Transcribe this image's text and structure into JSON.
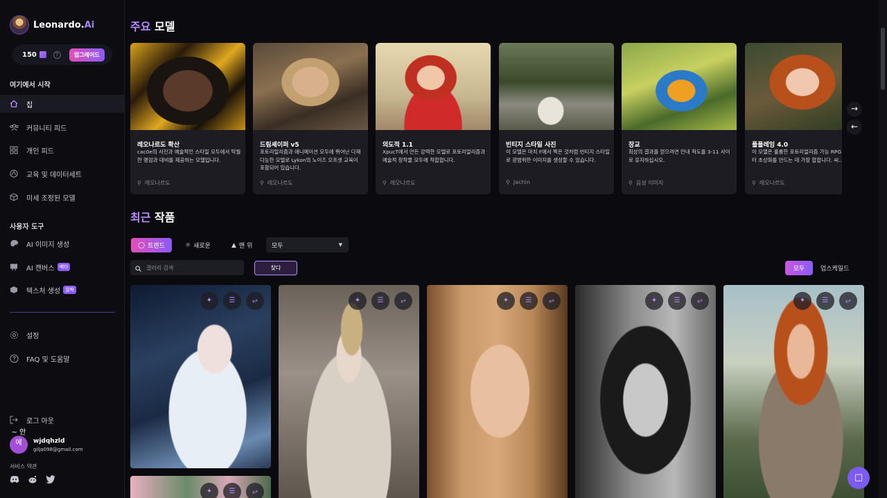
{
  "brand": {
    "name": "Leonardo.",
    "ai": "Ai"
  },
  "credits": {
    "amount": "150",
    "upgrade_label": "업그레이드"
  },
  "sidebar": {
    "start_heading": "여기에서 시작",
    "start_items": [
      {
        "label": "집",
        "icon": "home-icon"
      },
      {
        "label": "커뮤니티 피드",
        "icon": "users-icon"
      },
      {
        "label": "개인 피드",
        "icon": "grid-icon"
      },
      {
        "label": "교육 및 데이터세트",
        "icon": "dataset-icon"
      },
      {
        "label": "미세 조정된 모델",
        "icon": "cube-icon"
      }
    ],
    "tools_heading": "사용자 도구",
    "tool_items": [
      {
        "label": "AI 이미지 생성",
        "icon": "palette-icon",
        "badge": ""
      },
      {
        "label": "AI 캔버스",
        "icon": "canvas-icon",
        "badge": "베타"
      },
      {
        "label": "텍스처 생성",
        "icon": "texture-icon",
        "badge": "알파"
      }
    ],
    "settings_items": [
      {
        "label": "설정",
        "icon": "gear-icon"
      },
      {
        "label": "FAQ 및 도움말",
        "icon": "help-icon"
      }
    ],
    "logout_label": "로그 아웃",
    "user": {
      "avatar_text": "~ 안 에",
      "name": "wjdqhzld",
      "email": "gilja098@gmail.com"
    },
    "terms_label": "서비스 약관"
  },
  "featured": {
    "title_accent": "주요",
    "title_rest": " 모델",
    "models": [
      {
        "title": "레오나르도 확산",
        "desc": "cac0e의 사진과 예술적인 스타일 모두에서 탁월한 명암과 대비를 제공하는 모델입니다.",
        "author": "레오나르도"
      },
      {
        "title": "드림셰이퍼 v5",
        "desc": "포토리얼리즘과 애니메이션 모두에 뛰어난 다재다능한 모델로 Lykon의 노이즈 오프셋 교육이 포함되어 있습니다.",
        "author": "레오나르도"
      },
      {
        "title": "의도적 1.1",
        "desc": "XpucT에서 만든 강력한 모델로 포토리얼리즘과 예술적 창작물 모두에 적합합니다.",
        "author": "레오나르도"
      },
      {
        "title": "빈티지 스타일 사진",
        "desc": "이 모델은 마치 F에서 찍은 것처럼 빈티지 스타일로 광범위한 이미지를 생성할 수 있습니다.",
        "author": "Jachin"
      },
      {
        "title": "장교",
        "desc": "최상의 결과를 얻으려면 안내 척도를 3-11 사이로 유지하십시오.",
        "author": "음성 이미지"
      },
      {
        "title": "플플레잉 4.0",
        "desc": "이 모델은 훌륭한 포토리얼리즘 가능 RPG 캐릭터 초상화를 만드는 데 가장 합합니다. 씨...",
        "author": "레오나르도"
      }
    ]
  },
  "recent": {
    "title_accent": "최근",
    "title_rest": " 작품",
    "filters": [
      {
        "label": "트렌드",
        "icon": "flame-icon"
      },
      {
        "label": "새로운",
        "icon": "sparkle-icon"
      },
      {
        "label": "맨 위",
        "icon": "fire-icon"
      }
    ],
    "select_value": "모두",
    "search_placeholder": "갤러리 검색",
    "find_label": "찾다",
    "all_label": "모두",
    "upscaled_label": "업스케일드"
  }
}
